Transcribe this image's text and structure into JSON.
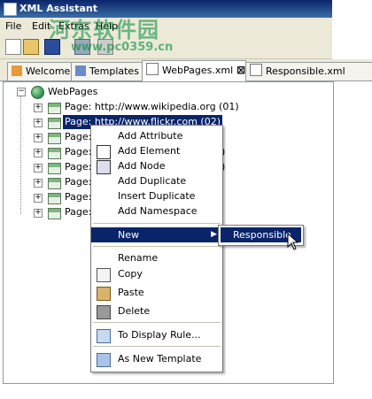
{
  "window": {
    "title": "XML Assistant"
  },
  "menu": [
    "File",
    "Edit",
    "Extras",
    "Help"
  ],
  "watermark": {
    "line1": "河东软件园",
    "line2": "www.pc0359.cn"
  },
  "tabs": [
    {
      "label": "Welcome",
      "icon": "home-icon"
    },
    {
      "label": "Templates",
      "icon": "templates-icon"
    },
    {
      "label": "WebPages.xml",
      "icon": "document-icon",
      "active": true,
      "closable": true
    },
    {
      "label": "Responsible.xml",
      "icon": "document-icon"
    }
  ],
  "tree": {
    "root": "WebPages",
    "nodes": [
      "Page: http://www.wikipedia.org (01)",
      "Page: http://www.flickr.com (02)",
      "Page:",
      "Page:",
      "Page:",
      "Page:",
      "Page:",
      "Page:"
    ],
    "partial_suffixes": [
      "",
      ")",
      ")",
      "",
      "",
      ""
    ]
  },
  "context_menu": {
    "items": [
      {
        "label": "Add Attribute",
        "icon": ""
      },
      {
        "label": "Add Element",
        "icon": "add-element-icon"
      },
      {
        "label": "Add Node",
        "icon": "add-node-icon"
      },
      {
        "label": "Add Duplicate",
        "icon": ""
      },
      {
        "label": "Insert Duplicate",
        "icon": ""
      },
      {
        "label": "Add Namespace",
        "icon": ""
      },
      {
        "label": "New",
        "icon": "",
        "submenu": true
      },
      {
        "label": "Rename",
        "icon": ""
      },
      {
        "label": "Copy",
        "icon": "copy-icon"
      },
      {
        "label": "Paste",
        "icon": "paste-icon"
      },
      {
        "label": "Delete",
        "icon": "trash-icon"
      },
      {
        "label": "To Display Rule...",
        "icon": "display-rule-icon"
      },
      {
        "label": "As New Template",
        "icon": "template-icon"
      }
    ],
    "submenu": {
      "label": "Responsible"
    }
  },
  "colors": {
    "selection": "#0a246a",
    "menubar": "#ece9d8"
  }
}
